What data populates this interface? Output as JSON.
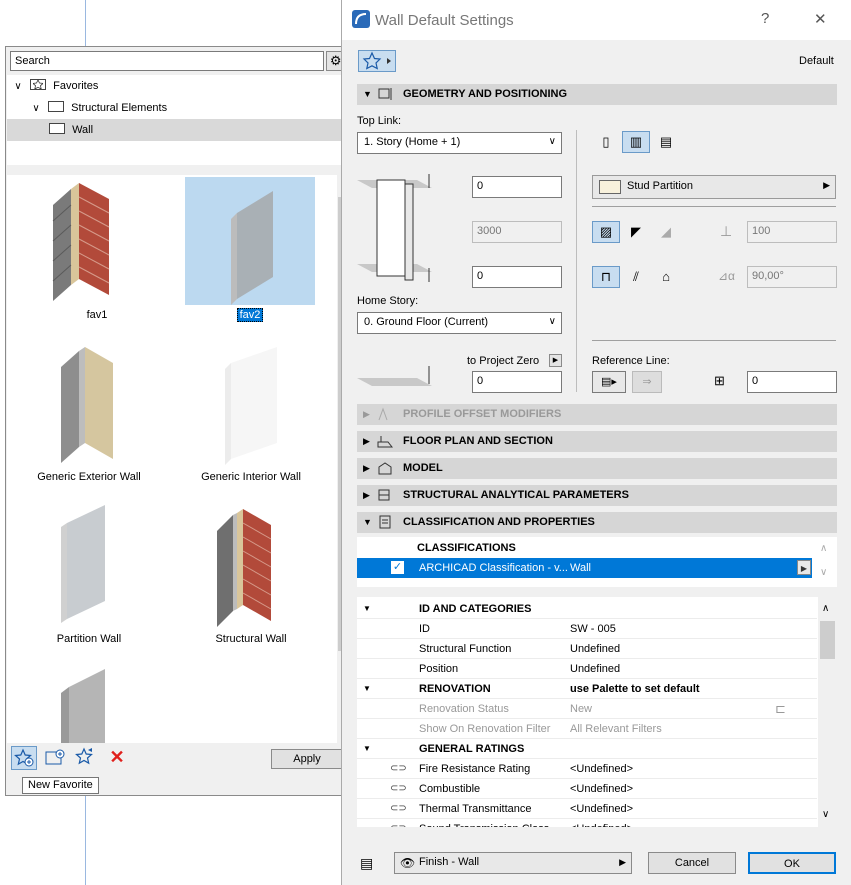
{
  "favorites": {
    "search_placeholder": "Search",
    "tree": [
      {
        "label": "Favorites"
      },
      {
        "label": "Structural Elements"
      },
      {
        "label": "Wall"
      }
    ],
    "items": [
      {
        "label": "fav1"
      },
      {
        "label": "fav2"
      },
      {
        "label": "Generic Exterior Wall"
      },
      {
        "label": "Generic Interior Wall"
      },
      {
        "label": "Partition Wall"
      },
      {
        "label": "Structural Wall"
      }
    ],
    "apply_label": "Apply",
    "tooltip": "New Favorite",
    "colors": {
      "selected_tile": "#bcd9f0",
      "delete": "#e0201c"
    }
  },
  "dialog": {
    "title": "Wall Default Settings",
    "help": "?",
    "close": "✕",
    "default_label": "Default",
    "sections": {
      "geometry": "GEOMETRY AND POSITIONING",
      "profile": "PROFILE OFFSET MODIFIERS",
      "floorplan": "FLOOR PLAN AND SECTION",
      "model": "MODEL",
      "structural": "STRUCTURAL ANALYTICAL PARAMETERS",
      "classification": "CLASSIFICATION AND PROPERTIES"
    },
    "geometry": {
      "top_link_label": "Top Link:",
      "top_link_value": "1. Story (Home + 1)",
      "top_offset": "0",
      "height": "3000",
      "bottom_offset": "0",
      "home_story_label": "Home Story:",
      "home_story_value": "0. Ground Floor (Current)",
      "to_project_zero_label": "to Project Zero",
      "project_zero_value": "0",
      "composite": "Stud Partition",
      "thickness": "100",
      "angle": "90,00°",
      "reference_line_label": "Reference Line:",
      "reference_offset": "0"
    },
    "classification": {
      "header": "CLASSIFICATIONS",
      "row_system": "ARCHICAD Classification - v...",
      "row_value": "Wall"
    },
    "properties": {
      "groups": [
        {
          "title": "ID AND CATEGORIES",
          "rows": [
            {
              "name": "ID",
              "value": "SW - 005"
            },
            {
              "name": "Structural Function",
              "value": "Undefined"
            },
            {
              "name": "Position",
              "value": "Undefined"
            }
          ]
        },
        {
          "title": "RENOVATION",
          "note": "use Palette to set default",
          "rows": [
            {
              "name": "Renovation Status",
              "value": "New"
            },
            {
              "name": "Show On Renovation Filter",
              "value": "All Relevant Filters"
            }
          ]
        },
        {
          "title": "GENERAL RATINGS",
          "rows": [
            {
              "name": "Fire Resistance Rating",
              "value": "<Undefined>"
            },
            {
              "name": "Combustible",
              "value": "<Undefined>"
            },
            {
              "name": "Thermal Transmittance",
              "value": "<Undefined>"
            },
            {
              "name": "Sound Transmission Class",
              "value": "<Undefined>"
            }
          ]
        }
      ]
    },
    "footer": {
      "layer": "Finish - Wall",
      "cancel": "Cancel",
      "ok": "OK"
    },
    "colors": {
      "accent": "#0078d7",
      "section_bg": "#d6d6d6",
      "ok_border": "#0078d7"
    }
  }
}
